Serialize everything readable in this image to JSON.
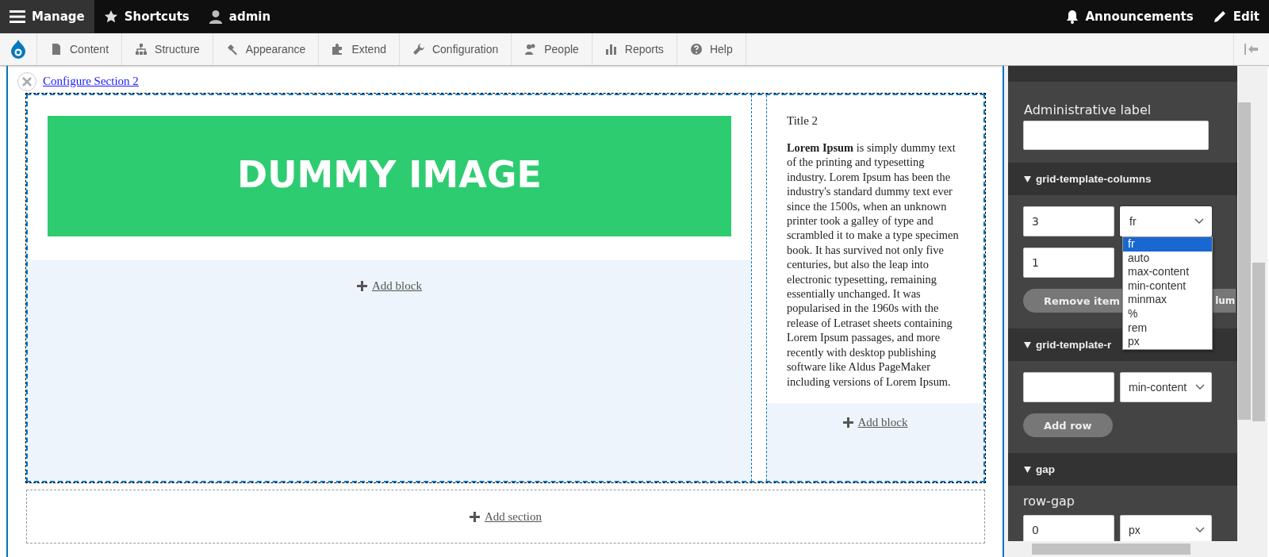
{
  "toolbar": {
    "items": [
      {
        "label": "Manage",
        "selected": true
      },
      {
        "label": "Shortcuts",
        "selected": false
      },
      {
        "label": "admin",
        "selected": false
      }
    ],
    "right_items": [
      {
        "label": "Announcements"
      },
      {
        "label": "Edit"
      }
    ]
  },
  "admin_menu": {
    "items": [
      {
        "label": "Content"
      },
      {
        "label": "Structure"
      },
      {
        "label": "Appearance"
      },
      {
        "label": "Extend"
      },
      {
        "label": "Configuration"
      },
      {
        "label": "People"
      },
      {
        "label": "Reports"
      },
      {
        "label": "Help"
      }
    ]
  },
  "layout_builder": {
    "section_link": "Configure Section 2",
    "image": {
      "kind": "picture",
      "text": "DUMMY IMAGE"
    },
    "add_block_left": "Add block",
    "title": "Title 2",
    "body": "**Lorem Ipsum** is simply dummy text of the printing and typesetting industry. Lorem Ipsum has been the industry's standard dummy text ever since the 1500s, when an unknown printer took a galley of type and scrambled it to make a type specimen book. It has survived not only five centuries, but also the leap into electronic typesetting, remaining essentially unchanged. It was popularised in the 1960s with the release of Letraset sheets containing Lorem Ipsum passages, and more recently with desktop publishing software like Aldus PageMaker including versions of Lorem Ipsum.",
    "add_block_right": "Add block",
    "add_section": "Add section"
  },
  "sidebar": {
    "admin_label": {
      "label": "Administrative label"
    },
    "sections": [
      {
        "title": "grid-template-columns",
        "expanded": true,
        "rows": [
          {
            "number": "3",
            "unit": "fr",
            "options": [
              {
                "label": "fr",
                "selected": true
              },
              {
                "label": "auto",
                "selected": false
              },
              {
                "label": "max-content",
                "selected": false
              },
              {
                "label": "min-content",
                "selected": false
              },
              {
                "label": "minmax",
                "selected": false
              },
              {
                "label": "%",
                "selected": false
              },
              {
                "label": "rem",
                "selected": false
              },
              {
                "label": "px",
                "selected": false
              }
            ]
          },
          {
            "number": "1"
          }
        ],
        "buttons": [
          "Remove item",
          "lum"
        ]
      },
      {
        "title": "grid-template-r",
        "expanded": true,
        "rows": [
          {
            "unit": "min-content"
          }
        ],
        "buttons": [
          "Add row"
        ]
      },
      {
        "title": "gap",
        "expanded": true,
        "label": "row-gap",
        "rows": [
          {
            "number": "0",
            "unit": "px"
          }
        ]
      }
    ]
  }
}
